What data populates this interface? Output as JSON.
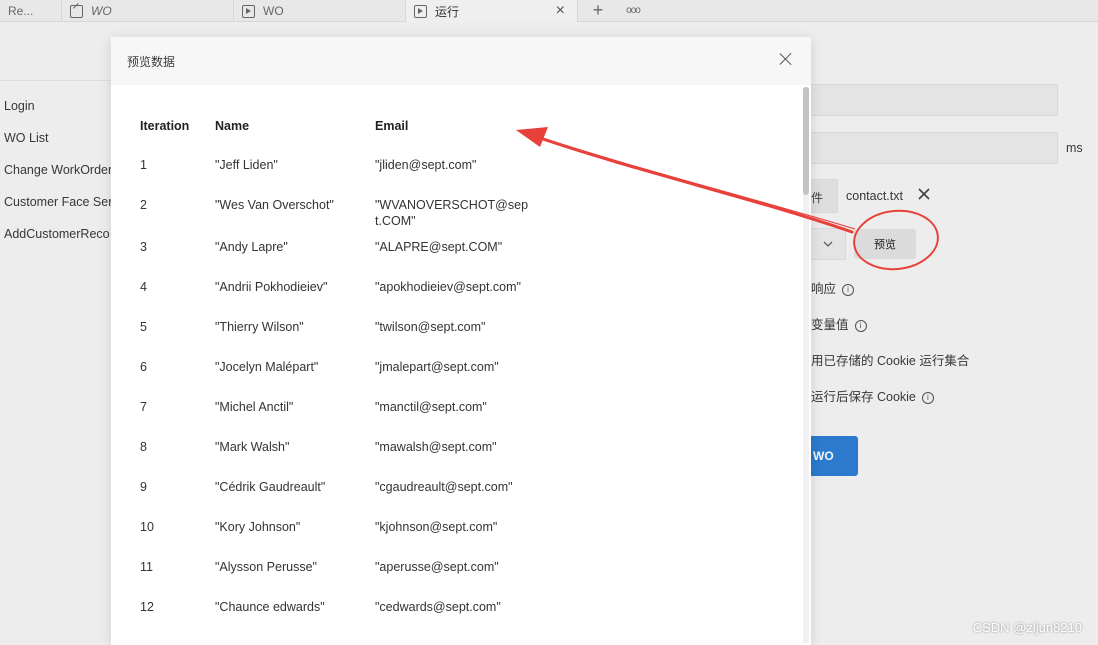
{
  "tabs": [
    {
      "label": "Re...",
      "icon": "none",
      "italic": false
    },
    {
      "label": "WO",
      "icon": "doc-icon",
      "italic": true
    },
    {
      "label": "WO",
      "icon": "play-icon",
      "italic": false
    },
    {
      "label": "运行",
      "icon": "play-icon",
      "italic": false,
      "active": true
    }
  ],
  "tab_close": "×",
  "tab_add": "+",
  "tab_more": "ooo",
  "left_items": [
    "Login",
    "WO List",
    "Change WorkOrder",
    "Customer Face Ser",
    "AddCustomerReco"
  ],
  "right": {
    "ms_unit": "ms",
    "file_btn_partial": "件",
    "file_name": "contact.txt",
    "preview_label": "预览",
    "opt_response": "响应",
    "opt_variables": "变量值",
    "opt_cookie_use": "用已存储的 Cookie 运行集合",
    "opt_cookie_save": "运行后保存 Cookie",
    "run_label": "WO"
  },
  "modal": {
    "title": "预览数据",
    "headers": [
      "Iteration",
      "Name",
      "Email"
    ],
    "rows": [
      [
        "1",
        "\"Jeff Liden\"",
        "\"jliden@sept.com\""
      ],
      [
        "2",
        "\"Wes Van Overschot\"",
        "\"WVANOVERSCHOT@sept.COM\""
      ],
      [
        "3",
        "\"Andy Lapre\"",
        "\"ALAPRE@sept.COM\""
      ],
      [
        "4",
        "\"Andrii Pokhodieiev\"",
        "\"apokhodieiev@sept.com\""
      ],
      [
        "5",
        "\"Thierry Wilson\"",
        "\"twilson@sept.com\""
      ],
      [
        "6",
        "\"Jocelyn Malépart\"",
        "\"jmalepart@sept.com\""
      ],
      [
        "7",
        "\"Michel Anctil\"",
        "\"manctil@sept.com\""
      ],
      [
        "8",
        "\"Mark Walsh\"",
        "\"mawalsh@sept.com\""
      ],
      [
        "9",
        "\"Cédrik Gaudreault\"",
        "\"cgaudreault@sept.com\""
      ],
      [
        "10",
        "\"Kory Johnson\"",
        "\"kjohnson@sept.com\""
      ],
      [
        "11",
        "\"Alysson Perusse\"",
        "\"aperusse@sept.com\""
      ],
      [
        "12",
        "\"Chaunce edwards\"",
        "\"cedwards@sept.com\""
      ]
    ]
  },
  "watermark": "CSDN @zljun8210",
  "colors": {
    "annotation": "#e8403a",
    "run_button": "#2e7fd6"
  }
}
